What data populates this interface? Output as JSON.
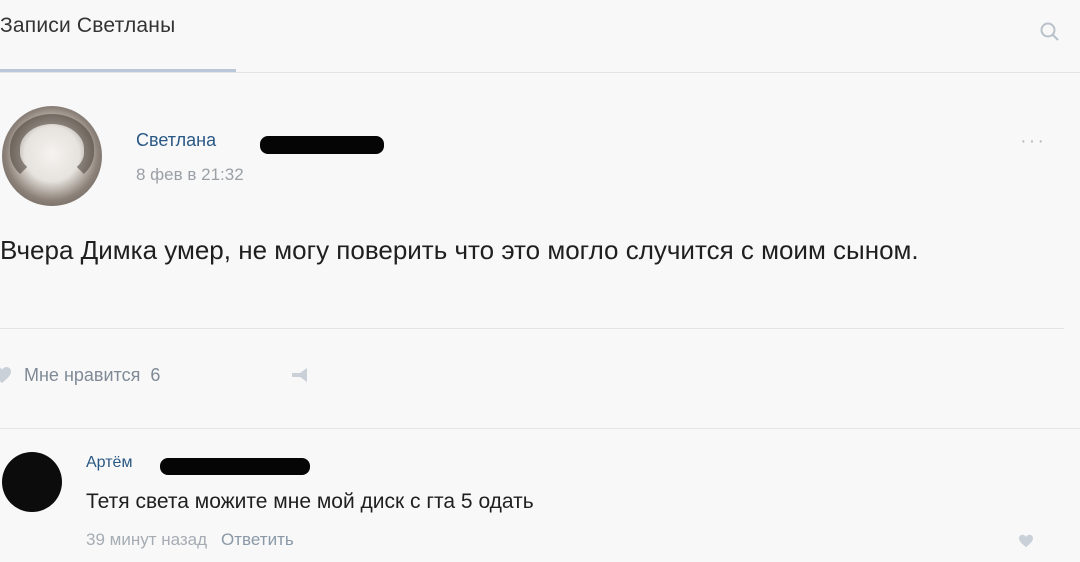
{
  "header": {
    "tab_label": "Записи Светланы",
    "search_icon": "search-icon"
  },
  "post": {
    "author_name": "Светлана",
    "date": "8 фев в 21:32",
    "more_icon": "more-dots-icon",
    "text": "Вчера Димка умер, не могу поверить что это могло случится с моим сыном.",
    "likes_label": "Мне нравится",
    "likes_count": "6",
    "share_icon": "share-icon"
  },
  "comment": {
    "author_name": "Артём",
    "text": "Тетя света можите мне мой диск с гта 5 одать",
    "time": "39 минут назад",
    "reply_label": "Ответить",
    "like_icon": "heart-icon"
  },
  "colors": {
    "link": "#2a5885",
    "muted": "#9aa0a6",
    "redaction": "#050505"
  }
}
